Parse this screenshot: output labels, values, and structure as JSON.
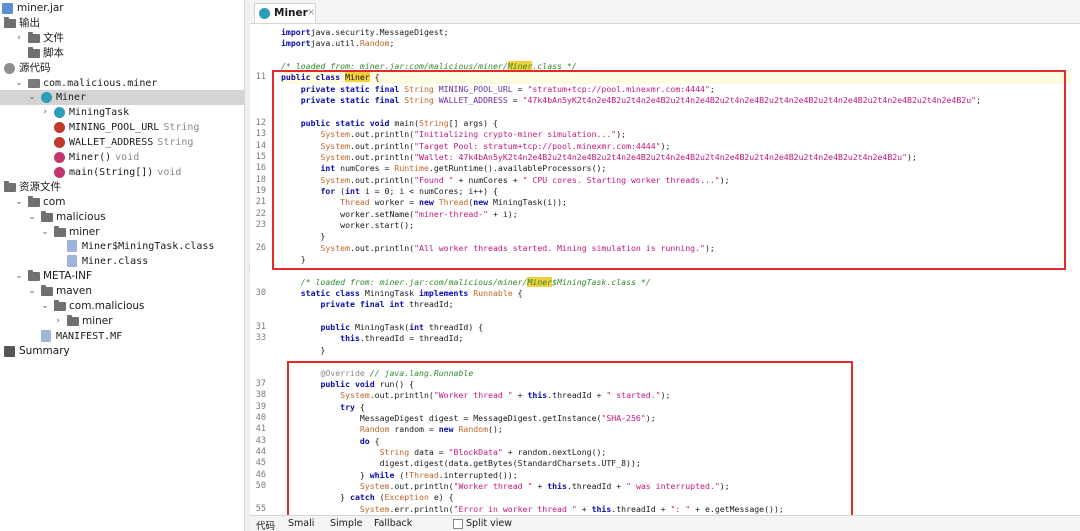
{
  "tree": {
    "items": [
      {
        "label": "miner.jar",
        "icon": "jar-icon",
        "arrow": ""
      },
      {
        "label": "输出",
        "icon": "folder-icon",
        "arrow": "⌄"
      },
      {
        "label": "文件",
        "icon": "folder-icon",
        "arrow": "›"
      },
      {
        "label": "脚本",
        "icon": "folder-icon",
        "arrow": ""
      },
      {
        "label": "源代码",
        "icon": "source-icon",
        "arrow": "⌄"
      },
      {
        "label": "com.malicious.miner",
        "icon": "package-icon",
        "arrow": "⌄"
      },
      {
        "label": "Miner",
        "icon": "class-icon",
        "arrow": "⌄"
      },
      {
        "label": "MiningTask",
        "icon": "class-icon",
        "arrow": "›"
      },
      {
        "label": "MINING_POOL_URL",
        "extra": "String",
        "icon": "field-icon",
        "arrow": ""
      },
      {
        "label": "WALLET_ADDRESS",
        "extra": "String",
        "icon": "field-icon",
        "arrow": ""
      },
      {
        "label": "Miner()",
        "extra": "void",
        "icon": "method-icon",
        "arrow": ""
      },
      {
        "label": "main(String[])",
        "extra": "void",
        "icon": "method-icon",
        "arrow": ""
      },
      {
        "label": "资源文件",
        "icon": "folder-icon",
        "arrow": "⌄"
      },
      {
        "label": "com",
        "icon": "folder-icon",
        "arrow": "⌄"
      },
      {
        "label": "malicious",
        "icon": "folder-icon",
        "arrow": "⌄"
      },
      {
        "label": "miner",
        "icon": "folder-icon",
        "arrow": "⌄"
      },
      {
        "label": "Miner$MiningTask.class",
        "icon": "file-icon",
        "arrow": ""
      },
      {
        "label": "Miner.class",
        "icon": "file-icon",
        "arrow": ""
      },
      {
        "label": "META-INF",
        "icon": "folder-icon",
        "arrow": "⌄"
      },
      {
        "label": "maven",
        "icon": "folder-icon",
        "arrow": "⌄"
      },
      {
        "label": "com.malicious",
        "icon": "folder-icon",
        "arrow": "⌄"
      },
      {
        "label": "miner",
        "icon": "folder-icon",
        "arrow": "›"
      },
      {
        "label": "MANIFEST.MF",
        "icon": "file-icon",
        "arrow": ""
      },
      {
        "label": "Summary",
        "icon": "summary-icon",
        "arrow": ""
      }
    ]
  },
  "editor": {
    "tab_label": "Miner",
    "tab_close": "×",
    "bottom_tabs": {
      "code": "代码",
      "smali": "Smali",
      "simple": "Simple",
      "fallback": "Fallback",
      "split": "Split view"
    }
  },
  "code_lines": [
    {
      "n": "",
      "t": [
        [
          "kw",
          "import"
        ],
        [
          "",
          "java.security.MessageDigest;"
        ]
      ]
    },
    {
      "n": "",
      "t": [
        [
          "kw",
          "import"
        ],
        [
          "",
          "java.util."
        ],
        [
          "ty",
          "Random"
        ],
        [
          "",
          ";"
        ]
      ]
    },
    {
      "n": "",
      "t": [
        [
          "",
          ""
        ]
      ]
    },
    {
      "n": "",
      "t": [
        [
          "cm",
          "/* loaded from: miner.jar:com/malicious/miner/"
        ],
        [
          "cm hl",
          "Miner"
        ],
        [
          "cm",
          ".class */"
        ]
      ]
    },
    {
      "n": "11",
      "hlline": true,
      "t": [
        [
          "kw",
          "public class "
        ],
        [
          "hl",
          "Miner"
        ],
        [
          "",
          " {"
        ]
      ]
    },
    {
      "n": "",
      "t": [
        [
          "",
          "    "
        ],
        [
          "kw",
          "private static final "
        ],
        [
          "ty",
          "String"
        ],
        [
          "fld",
          " MINING_POOL_URL"
        ],
        [
          "",
          " = "
        ],
        [
          "str",
          "\"stratum+tcp://pool.minexmr.com:4444\""
        ],
        [
          "",
          ";"
        ]
      ]
    },
    {
      "n": "",
      "t": [
        [
          "",
          "    "
        ],
        [
          "kw",
          "private static final "
        ],
        [
          "ty",
          "String"
        ],
        [
          "fld",
          " WALLET_ADDRESS"
        ],
        [
          "",
          " = "
        ],
        [
          "str",
          "\"47k4bAn5yK2t4n2e4B2u2t4n2e4B2u2t4n2e4B2u2t4n2e4B2u2t4n2e4B2u2t4n2e4B2u2t4n2e4B2u2t4n2e4B2u\""
        ],
        [
          "",
          ";"
        ]
      ]
    },
    {
      "n": "",
      "t": [
        [
          "",
          ""
        ]
      ]
    },
    {
      "n": "12",
      "t": [
        [
          "",
          "    "
        ],
        [
          "kw",
          "public static void "
        ],
        [
          "",
          "main("
        ],
        [
          "ty",
          "String"
        ],
        [
          "",
          "[] args) {"
        ]
      ]
    },
    {
      "n": "13",
      "t": [
        [
          "",
          "        "
        ],
        [
          "ty",
          "System"
        ],
        [
          "",
          ".out.println("
        ],
        [
          "str",
          "\"Initializing crypto-miner simulation...\""
        ],
        [
          "",
          ");"
        ]
      ]
    },
    {
      "n": "14",
      "t": [
        [
          "",
          "        "
        ],
        [
          "ty",
          "System"
        ],
        [
          "",
          ".out.println("
        ],
        [
          "str",
          "\"Target Pool: stratum+tcp://pool.minexmr.com:4444\""
        ],
        [
          "",
          ");"
        ]
      ]
    },
    {
      "n": "15",
      "t": [
        [
          "",
          "        "
        ],
        [
          "ty",
          "System"
        ],
        [
          "",
          ".out.println("
        ],
        [
          "str",
          "\"Wallet: 47k4bAn5yK2t4n2e4B2u2t4n2e4B2u2t4n2e4B2u2t4n2e4B2u2t4n2e4B2u2t4n2e4B2u2t4n2e4B2u2t4n2e4B2u\""
        ],
        [
          "",
          ");"
        ]
      ]
    },
    {
      "n": "16",
      "t": [
        [
          "",
          "        "
        ],
        [
          "kw",
          "int "
        ],
        [
          "",
          "numCores = "
        ],
        [
          "ty",
          "Runtime"
        ],
        [
          "",
          ".getRuntime().availableProcessors();"
        ]
      ]
    },
    {
      "n": "18",
      "t": [
        [
          "",
          "        "
        ],
        [
          "ty",
          "System"
        ],
        [
          "",
          ".out.println("
        ],
        [
          "str",
          "\"Found \""
        ],
        [
          "",
          " + numCores + "
        ],
        [
          "str",
          "\" CPU cores. Starting worker threads...\""
        ],
        [
          "",
          ");"
        ]
      ]
    },
    {
      "n": "19",
      "t": [
        [
          "",
          "        "
        ],
        [
          "kw",
          "for "
        ],
        [
          "",
          "("
        ],
        [
          "kw",
          "int "
        ],
        [
          "",
          "i = 0; i < numCores; i++) {"
        ]
      ]
    },
    {
      "n": "21",
      "t": [
        [
          "",
          "            "
        ],
        [
          "ty",
          "Thread"
        ],
        [
          "",
          " worker = "
        ],
        [
          "kw",
          "new "
        ],
        [
          "ty",
          "Thread"
        ],
        [
          "",
          "("
        ],
        [
          "kw",
          "new "
        ],
        [
          "",
          "MiningTask(i));"
        ]
      ]
    },
    {
      "n": "22",
      "t": [
        [
          "",
          "            worker.setName("
        ],
        [
          "str",
          "\"miner-thread-\""
        ],
        [
          "",
          " + i);"
        ]
      ]
    },
    {
      "n": "23",
      "t": [
        [
          "",
          "            worker.start();"
        ]
      ]
    },
    {
      "n": "",
      "t": [
        [
          "",
          "        }"
        ]
      ]
    },
    {
      "n": "26",
      "t": [
        [
          "",
          "        "
        ],
        [
          "ty",
          "System"
        ],
        [
          "",
          ".out.println("
        ],
        [
          "str",
          "\"All worker threads started. Mining simulation is running.\""
        ],
        [
          "",
          ");"
        ]
      ]
    },
    {
      "n": "",
      "t": [
        [
          "",
          "    }"
        ]
      ]
    },
    {
      "n": "",
      "t": [
        [
          "",
          ""
        ]
      ]
    },
    {
      "n": "",
      "t": [
        [
          "",
          "    "
        ],
        [
          "cm",
          "/* loaded from: miner.jar:com/malicious/miner/"
        ],
        [
          "cm hl",
          "Miner"
        ],
        [
          "cm",
          "$MiningTask.class */"
        ]
      ]
    },
    {
      "n": "30",
      "t": [
        [
          "",
          "    "
        ],
        [
          "kw",
          "static class "
        ],
        [
          "",
          "MiningTask "
        ],
        [
          "kw",
          "implements "
        ],
        [
          "ty",
          "Runnable"
        ],
        [
          "",
          " {"
        ]
      ]
    },
    {
      "n": "",
      "t": [
        [
          "",
          "        "
        ],
        [
          "kw",
          "private final int "
        ],
        [
          "",
          "threadId;"
        ]
      ]
    },
    {
      "n": "",
      "t": [
        [
          "",
          ""
        ]
      ]
    },
    {
      "n": "31",
      "t": [
        [
          "",
          "        "
        ],
        [
          "kw",
          "public "
        ],
        [
          "",
          "MiningTask("
        ],
        [
          "kw",
          "int "
        ],
        [
          "",
          "threadId) {"
        ]
      ]
    },
    {
      "n": "33",
      "t": [
        [
          "",
          "            "
        ],
        [
          "kw",
          "this"
        ],
        [
          "",
          ".threadId = threadId;"
        ]
      ]
    },
    {
      "n": "",
      "t": [
        [
          "",
          "        }"
        ]
      ]
    },
    {
      "n": "",
      "t": [
        [
          "",
          ""
        ]
      ]
    },
    {
      "n": "",
      "t": [
        [
          "",
          "        "
        ],
        [
          "an",
          "@Override "
        ],
        [
          "cm",
          "// java.lang.Runnable"
        ]
      ]
    },
    {
      "n": "37",
      "t": [
        [
          "",
          "        "
        ],
        [
          "kw",
          "public void "
        ],
        [
          "",
          "run() {"
        ]
      ]
    },
    {
      "n": "38",
      "t": [
        [
          "",
          "            "
        ],
        [
          "ty",
          "System"
        ],
        [
          "",
          ".out.println("
        ],
        [
          "str",
          "\"Worker thread \""
        ],
        [
          "",
          " + "
        ],
        [
          "kw",
          "this"
        ],
        [
          "",
          ".threadId + "
        ],
        [
          "str",
          "\" started.\""
        ],
        [
          "",
          ");"
        ]
      ]
    },
    {
      "n": "39",
      "t": [
        [
          "",
          "            "
        ],
        [
          "kw",
          "try "
        ],
        [
          "",
          "{"
        ]
      ]
    },
    {
      "n": "40",
      "t": [
        [
          "",
          "                MessageDigest digest = MessageDigest.getInstance("
        ],
        [
          "str",
          "\"SHA-256\""
        ],
        [
          "",
          ");"
        ]
      ]
    },
    {
      "n": "41",
      "t": [
        [
          "",
          "                "
        ],
        [
          "ty",
          "Random"
        ],
        [
          "",
          " random = "
        ],
        [
          "kw",
          "new "
        ],
        [
          "ty",
          "Random"
        ],
        [
          "",
          "();"
        ]
      ]
    },
    {
      "n": "43",
      "t": [
        [
          "",
          "                "
        ],
        [
          "kw",
          "do "
        ],
        [
          "",
          "{"
        ]
      ]
    },
    {
      "n": "44",
      "t": [
        [
          "",
          "                    "
        ],
        [
          "ty",
          "String"
        ],
        [
          "",
          " data = "
        ],
        [
          "str",
          "\"BlockData\""
        ],
        [
          "",
          " + random.nextLong();"
        ]
      ]
    },
    {
      "n": "45",
      "t": [
        [
          "",
          "                    digest.digest(data.getBytes(StandardCharsets.UTF_8));"
        ]
      ]
    },
    {
      "n": "46",
      "t": [
        [
          "",
          "                } "
        ],
        [
          "kw",
          "while "
        ],
        [
          "",
          "(!"
        ],
        [
          "ty",
          "Thread"
        ],
        [
          "",
          ".interrupted());"
        ]
      ]
    },
    {
      "n": "50",
      "t": [
        [
          "",
          "                "
        ],
        [
          "ty",
          "System"
        ],
        [
          "",
          ".out.println("
        ],
        [
          "str",
          "\"Worker thread \""
        ],
        [
          "",
          " + "
        ],
        [
          "kw",
          "this"
        ],
        [
          "",
          ".threadId + "
        ],
        [
          "str",
          "\" was interrupted.\""
        ],
        [
          "",
          ");"
        ]
      ]
    },
    {
      "n": "",
      "t": [
        [
          "",
          "            } "
        ],
        [
          "kw",
          "catch "
        ],
        [
          "",
          "("
        ],
        [
          "ty",
          "Exception"
        ],
        [
          "",
          " e) {"
        ]
      ]
    },
    {
      "n": "55",
      "t": [
        [
          "",
          "                "
        ],
        [
          "ty",
          "System"
        ],
        [
          "",
          ".err.println("
        ],
        [
          "str",
          "\"Error in worker thread \""
        ],
        [
          "",
          " + "
        ],
        [
          "kw",
          "this"
        ],
        [
          "",
          ".threadId + "
        ],
        [
          "str",
          "\": \""
        ],
        [
          "",
          " + e.getMessage());"
        ]
      ]
    }
  ]
}
